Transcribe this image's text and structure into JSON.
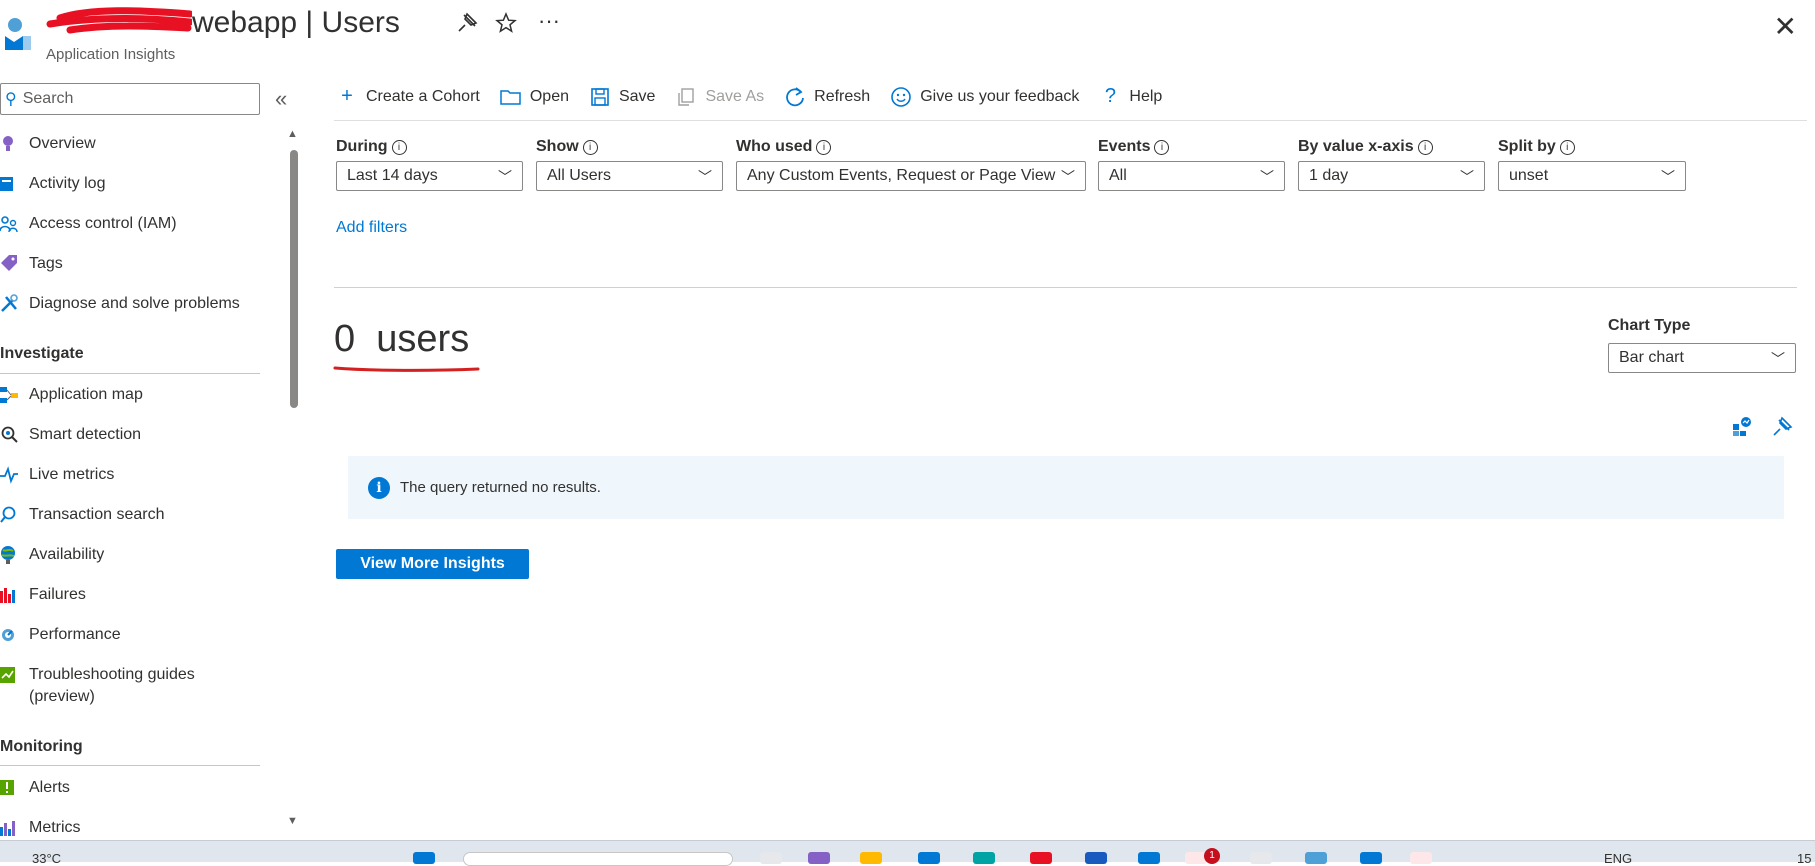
{
  "header": {
    "title_suffix": "webapp | Users",
    "subtitle": "Application Insights",
    "pin_icon": "pin-icon",
    "favorite_icon": "star-icon",
    "more_label": "···",
    "close_label": "✕"
  },
  "sidebar": {
    "search_placeholder": "Search",
    "collapse_label": "«",
    "items": [
      {
        "label": "Overview",
        "icon": "overview-icon",
        "color": "#8661c5"
      },
      {
        "label": "Activity log",
        "icon": "activity-log-icon",
        "color": "#0078d4"
      },
      {
        "label": "Access control (IAM)",
        "icon": "iam-icon",
        "color": "#0078d4"
      },
      {
        "label": "Tags",
        "icon": "tag-icon",
        "color": "#8661c5"
      },
      {
        "label": "Diagnose and solve problems",
        "icon": "wrench-icon",
        "color": "#0078d4"
      }
    ],
    "section_investigate": "Investigate",
    "investigate_items": [
      {
        "label": "Application map",
        "icon": "app-map-icon"
      },
      {
        "label": "Smart detection",
        "icon": "smart-detection-icon"
      },
      {
        "label": "Live metrics",
        "icon": "live-metrics-icon"
      },
      {
        "label": "Transaction search",
        "icon": "search-icon"
      },
      {
        "label": "Availability",
        "icon": "globe-icon"
      },
      {
        "label": "Failures",
        "icon": "failures-icon"
      },
      {
        "label": "Performance",
        "icon": "performance-icon"
      },
      {
        "label": "Troubleshooting guides",
        "label2": "(preview)",
        "icon": "guide-icon"
      }
    ],
    "section_monitoring": "Monitoring",
    "monitoring_items": [
      {
        "label": "Alerts",
        "icon": "alert-icon"
      },
      {
        "label": "Metrics",
        "icon": "metrics-icon"
      }
    ]
  },
  "toolbar": {
    "create_cohort": "Create a Cohort",
    "open": "Open",
    "save": "Save",
    "save_as": "Save As",
    "refresh": "Refresh",
    "feedback": "Give us your feedback",
    "help": "Help"
  },
  "filters": {
    "during": {
      "label": "During",
      "value": "Last 14 days"
    },
    "show": {
      "label": "Show",
      "value": "All Users"
    },
    "who_used": {
      "label": "Who used",
      "value": "Any Custom Events, Request or Page View"
    },
    "events": {
      "label": "Events",
      "value": "All"
    },
    "by_value": {
      "label": "By value x-axis",
      "value": "1 day"
    },
    "split_by": {
      "label": "Split by",
      "value": "unset"
    },
    "add_filters": "Add filters"
  },
  "result": {
    "count": "0",
    "unit": "users",
    "chart_type_label": "Chart Type",
    "chart_type_value": "Bar chart",
    "no_results": "The query returned no results.",
    "view_more": "View More Insights"
  },
  "taskbar": {
    "temperature": "33°C",
    "language": "ENG",
    "time": "15",
    "notification_count": "1"
  },
  "colors": {
    "accent": "#0078d4",
    "annotation_red": "#d32020"
  }
}
